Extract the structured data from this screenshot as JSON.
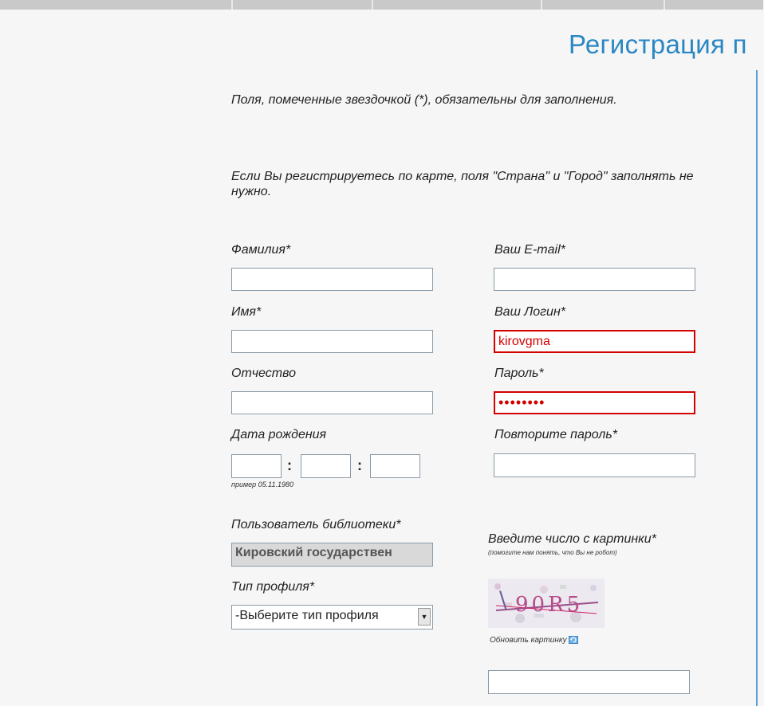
{
  "page": {
    "title": "Регистрация п",
    "required_note": "Поля, помеченные звездочкой (*), обязательны для заполнения.",
    "map_note": "Если Вы регистрируетесь по карте, поля \"Страна\" и \"Город\" заполнять не нужно."
  },
  "left": {
    "surname_label": "Фамилия*",
    "surname_value": "",
    "name_label": "Имя*",
    "name_value": "",
    "patronymic_label": "Отчество",
    "patronymic_value": "",
    "birth_label": "Дата рождения",
    "birth_day": "",
    "birth_month": "",
    "birth_year": "",
    "date_separator": ":",
    "birth_example": "пример 05.11.1980",
    "library_label": "Пользователь библиотеки*",
    "library_value": "Кировский государствен",
    "profile_label": "Тип профиля*",
    "profile_selected": "-Выберите тип профиля"
  },
  "right": {
    "email_label": "Ваш E-mail*",
    "email_value": "",
    "login_label": "Ваш Логин*",
    "login_value": "kirovgma",
    "password_label": "Пароль*",
    "password_value": "••••••••",
    "repeat_label": "Повторите пароль*",
    "repeat_value": "",
    "captcha_label": "Введите число с картинки*",
    "captcha_hint": "(помогите нам понять, что Вы не робот)",
    "captcha_text": "90R5",
    "refresh_label": "Обновить картинку",
    "captcha_value": ""
  },
  "colors": {
    "title": "#2a87c4",
    "error": "#d40000",
    "divider": "#5aa0d8"
  },
  "icons": {
    "select_arrow": "chevron-down-icon",
    "refresh": "refresh-icon"
  }
}
